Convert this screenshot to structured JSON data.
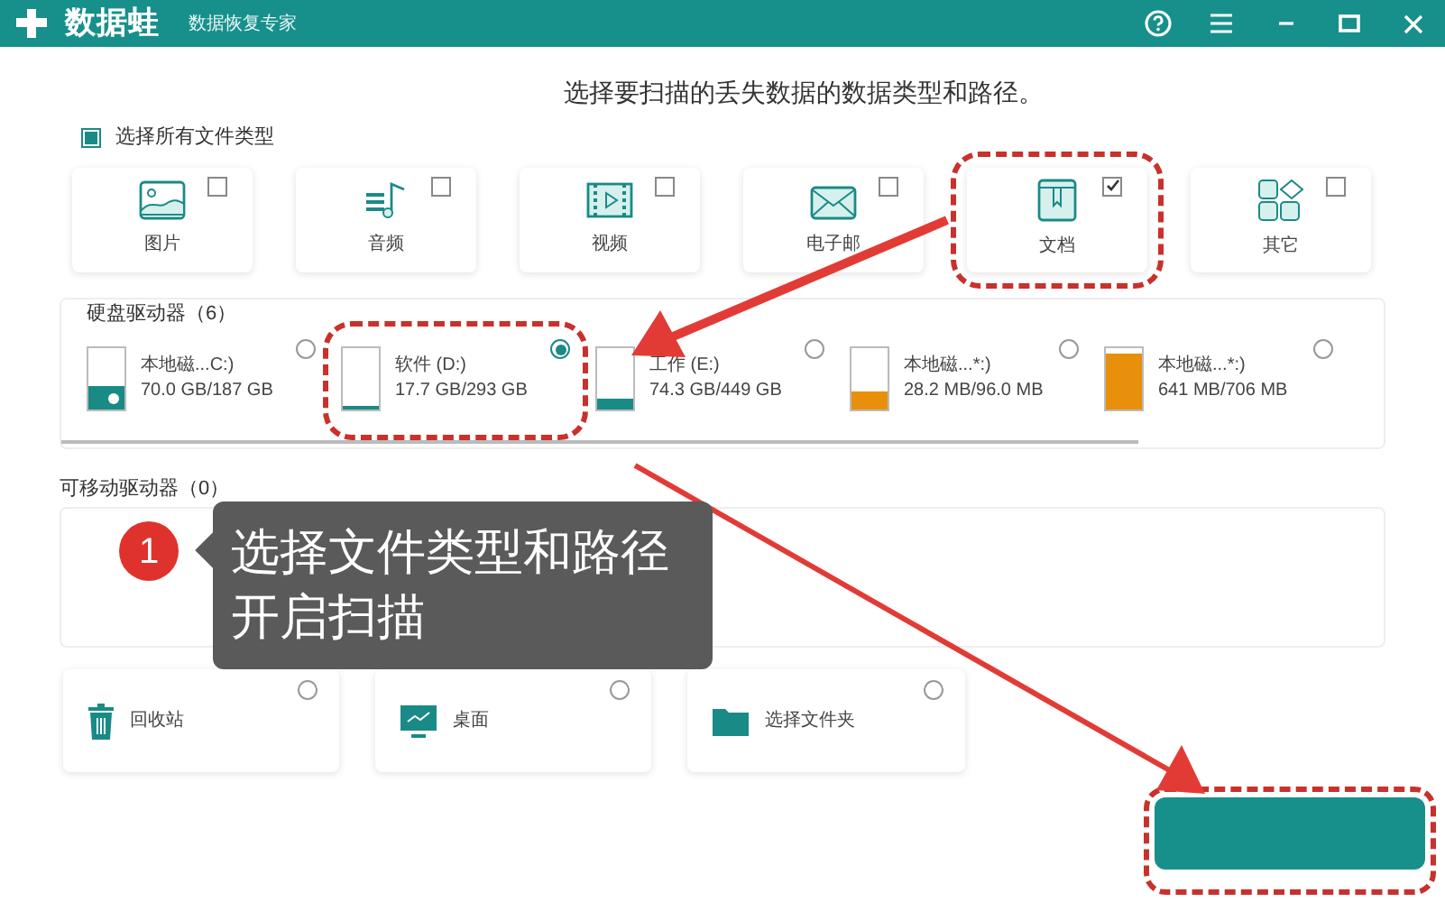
{
  "window": {
    "app_name": "数据蛙",
    "subtitle": "数据恢复专家"
  },
  "heading": "选择要扫描的丢失数据的数据类型和路径。",
  "select_all": {
    "label": "选择所有文件类型",
    "checked": true
  },
  "file_types": [
    {
      "label": "图片",
      "kind": "image",
      "checked": false,
      "highlighted": false
    },
    {
      "label": "音频",
      "kind": "audio",
      "checked": false,
      "highlighted": false
    },
    {
      "label": "视频",
      "kind": "video",
      "checked": false,
      "highlighted": false
    },
    {
      "label": "电子邮",
      "kind": "email",
      "checked": false,
      "highlighted": false
    },
    {
      "label": "文档",
      "kind": "document",
      "checked": true,
      "highlighted": true
    },
    {
      "label": "其它",
      "kind": "other",
      "checked": false,
      "highlighted": false
    }
  ],
  "hard_drives": {
    "title": "硬盘驱动器（6）",
    "drives": [
      {
        "name": "本地磁...C:)",
        "usage": "70.0 GB/187 GB",
        "level": 0.37,
        "color": "#1a8a86",
        "selected": false,
        "highlighted": false,
        "system": true
      },
      {
        "name": "软件 (D:)",
        "usage": "17.7 GB/293 GB",
        "level": 0.06,
        "color": "#1a8a86",
        "selected": true,
        "highlighted": true,
        "system": false
      },
      {
        "name": "工作 (E:)",
        "usage": "74.3 GB/449 GB",
        "level": 0.17,
        "color": "#1a8a86",
        "selected": false,
        "highlighted": false,
        "system": false
      },
      {
        "name": "本地磁...*:)",
        "usage": "28.2 MB/96.0 MB",
        "level": 0.3,
        "color": "#e8900c",
        "selected": false,
        "highlighted": false,
        "system": false
      },
      {
        "name": "本地磁...*:)",
        "usage": "641 MB/706 MB",
        "level": 0.91,
        "color": "#e8900c",
        "selected": false,
        "highlighted": false,
        "system": false
      }
    ]
  },
  "removable": {
    "title": "可移动驱动器（0）"
  },
  "locations": [
    {
      "label": "回收站",
      "kind": "recycle",
      "selected": false
    },
    {
      "label": "桌面",
      "kind": "desktop",
      "selected": false
    },
    {
      "label": "选择文件夹",
      "kind": "folder",
      "selected": false
    }
  ],
  "annotation": {
    "step": "1",
    "lines": [
      "选择文件类型和路径",
      "开启扫描"
    ]
  },
  "scan_button": {
    "highlighted": true
  }
}
